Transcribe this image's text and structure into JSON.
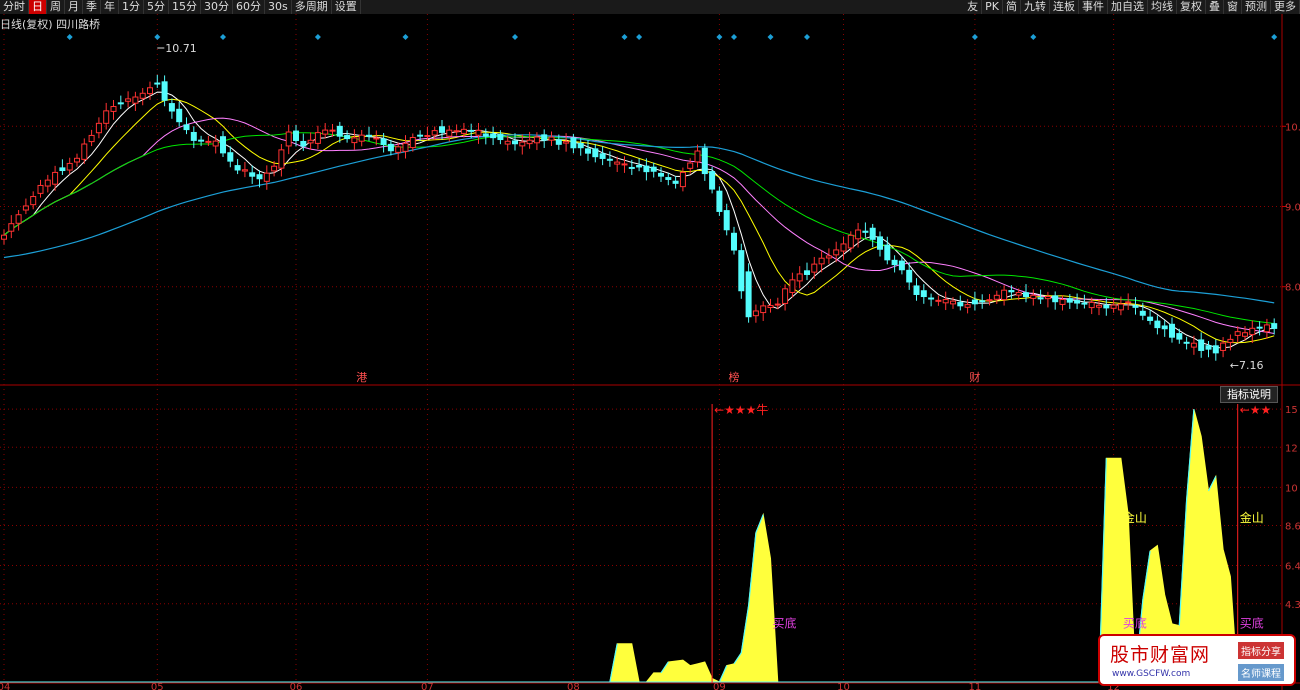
{
  "toolbar": {
    "left": [
      "分时",
      "日",
      "周",
      "月",
      "季",
      "年",
      "1分",
      "5分",
      "15分",
      "30分",
      "60分",
      "30s",
      "多周期",
      "设置"
    ],
    "active": "日",
    "right": [
      "友",
      "PK",
      "简",
      "九转",
      "连板",
      "事件",
      "加自选",
      "均线",
      "复权",
      "叠",
      "窗",
      "预测",
      "更多"
    ]
  },
  "info": {
    "period": "日线(复权)",
    "stock": "四川路桥"
  },
  "indicator_button": "指标说明",
  "watermark": {
    "title": "股市财富网",
    "url": "www.GSCFW.com",
    "tag1": "指标分享",
    "tag2": "名师课程"
  },
  "colors": {
    "up": "#ff3232",
    "down": "#54fcfc",
    "ma5": "#ffffff",
    "ma10": "#ffff00",
    "ma20": "#ff80ff",
    "ma30": "#00e600",
    "ma60": "#1c9fd6",
    "grid": "#8b0000",
    "bar": "#ffff3c"
  },
  "chart_data": [
    {
      "type": "candlestick",
      "title": "",
      "y_ticks": [
        8.0,
        9.0,
        10.0
      ],
      "y_tick_labels": [
        "8.0",
        "9.0",
        "10.0"
      ],
      "ylim": [
        6.8,
        11.2
      ],
      "x_months": [
        "04",
        "05",
        "06",
        "07",
        "08",
        "09",
        "10",
        "11",
        "12"
      ],
      "month_starts": [
        0,
        21,
        40,
        58,
        78,
        98,
        115,
        133,
        152
      ],
      "annotations": {
        "high": "10.71",
        "high_index": 21,
        "low": "7.16",
        "low_index": 166
      },
      "events": [
        {
          "label": "港",
          "index": 49
        },
        {
          "label": "榜",
          "index": 100
        },
        {
          "label": "财",
          "index": 133
        }
      ],
      "marker_indices": [
        9,
        21,
        30,
        43,
        55,
        70,
        85,
        87,
        98,
        100,
        105,
        110,
        133,
        141,
        174
      ],
      "key_closes": [
        [
          0,
          8.65
        ],
        [
          5,
          9.25
        ],
        [
          10,
          9.6
        ],
        [
          14,
          10.2
        ],
        [
          17,
          10.35
        ],
        [
          19,
          10.4
        ],
        [
          21,
          10.55
        ],
        [
          23,
          10.15
        ],
        [
          26,
          9.85
        ],
        [
          29,
          9.8
        ],
        [
          32,
          9.45
        ],
        [
          35,
          9.35
        ],
        [
          37,
          9.5
        ],
        [
          39,
          9.9
        ],
        [
          41,
          9.75
        ],
        [
          44,
          9.95
        ],
        [
          47,
          9.85
        ],
        [
          50,
          9.9
        ],
        [
          53,
          9.7
        ],
        [
          56,
          9.85
        ],
        [
          60,
          9.95
        ],
        [
          64,
          9.95
        ],
        [
          67,
          9.85
        ],
        [
          70,
          9.8
        ],
        [
          74,
          9.85
        ],
        [
          78,
          9.75
        ],
        [
          82,
          9.6
        ],
        [
          86,
          9.5
        ],
        [
          89,
          9.4
        ],
        [
          92,
          9.3
        ],
        [
          95,
          9.65
        ],
        [
          98,
          8.95
        ],
        [
          100,
          8.45
        ],
        [
          101,
          8.1
        ],
        [
          102,
          7.65
        ],
        [
          104,
          7.75
        ],
        [
          106,
          7.8
        ],
        [
          108,
          8.1
        ],
        [
          110,
          8.15
        ],
        [
          112,
          8.35
        ],
        [
          114,
          8.45
        ],
        [
          116,
          8.65
        ],
        [
          118,
          8.7
        ],
        [
          119,
          8.6
        ],
        [
          121,
          8.35
        ],
        [
          123,
          8.2
        ],
        [
          125,
          7.9
        ],
        [
          127,
          7.85
        ],
        [
          129,
          7.85
        ],
        [
          131,
          7.78
        ],
        [
          133,
          7.8
        ],
        [
          135,
          7.85
        ],
        [
          137,
          7.95
        ],
        [
          139,
          7.9
        ],
        [
          142,
          7.85
        ],
        [
          145,
          7.82
        ],
        [
          148,
          7.78
        ],
        [
          151,
          7.75
        ],
        [
          154,
          7.8
        ],
        [
          156,
          7.65
        ],
        [
          158,
          7.5
        ],
        [
          160,
          7.38
        ],
        [
          162,
          7.3
        ],
        [
          164,
          7.22
        ],
        [
          166,
          7.2
        ],
        [
          168,
          7.35
        ],
        [
          170,
          7.45
        ],
        [
          172,
          7.5
        ]
      ]
    },
    {
      "type": "area",
      "title": "",
      "y_ticks": [
        4.3,
        6.4,
        8.6,
        10.7,
        12.9,
        15.0
      ],
      "y_tick_labels": [
        "4.3",
        "6.4",
        "8.6",
        "10",
        "12",
        "15"
      ],
      "ylim": [
        0,
        15.5
      ],
      "values": [
        [
          0,
          0
        ],
        [
          83,
          0
        ],
        [
          84,
          2.1
        ],
        [
          86,
          2.1
        ],
        [
          87,
          0
        ],
        [
          88,
          0
        ],
        [
          89,
          0.5
        ],
        [
          90,
          0.5
        ],
        [
          91,
          1.1
        ],
        [
          93,
          1.2
        ],
        [
          94,
          0.9
        ],
        [
          95,
          1.0
        ],
        [
          96,
          1.1
        ],
        [
          97,
          0.2
        ],
        [
          98,
          0
        ],
        [
          99,
          0.9
        ],
        [
          100,
          1.0
        ],
        [
          101,
          1.6
        ],
        [
          102,
          4.2
        ],
        [
          103,
          8.2
        ],
        [
          104,
          9.2
        ],
        [
          105,
          6.8
        ],
        [
          106,
          0
        ],
        [
          150,
          0
        ],
        [
          151,
          12.3
        ],
        [
          153,
          12.3
        ],
        [
          154,
          9.2
        ],
        [
          155,
          0.3
        ],
        [
          156,
          4.5
        ],
        [
          157,
          7.2
        ],
        [
          158,
          7.5
        ],
        [
          159,
          4.8
        ],
        [
          160,
          3.2
        ],
        [
          161,
          3.1
        ],
        [
          162,
          10.0
        ],
        [
          163,
          15.0
        ],
        [
          164,
          13.5
        ],
        [
          165,
          10.5
        ],
        [
          166,
          11.3
        ],
        [
          167,
          7.3
        ],
        [
          168,
          5.8
        ],
        [
          169,
          0
        ]
      ],
      "signals": [
        {
          "type": "star_line",
          "index": 97,
          "label": "★★★牛"
        },
        {
          "type": "star_line",
          "index": 169,
          "label": "★★"
        }
      ],
      "labels": [
        {
          "text": "买底",
          "index": 105,
          "y": 3.0,
          "color": "#e040e0"
        },
        {
          "text": "金山",
          "index": 153,
          "y": 8.8,
          "color": "#ffff3c"
        },
        {
          "text": "买底",
          "index": 153,
          "y": 3.0,
          "color": "#e040e0"
        },
        {
          "text": "金山",
          "index": 169,
          "y": 8.8,
          "color": "#ffff3c"
        },
        {
          "text": "买底",
          "index": 169,
          "y": 3.0,
          "color": "#e040e0"
        }
      ]
    }
  ]
}
